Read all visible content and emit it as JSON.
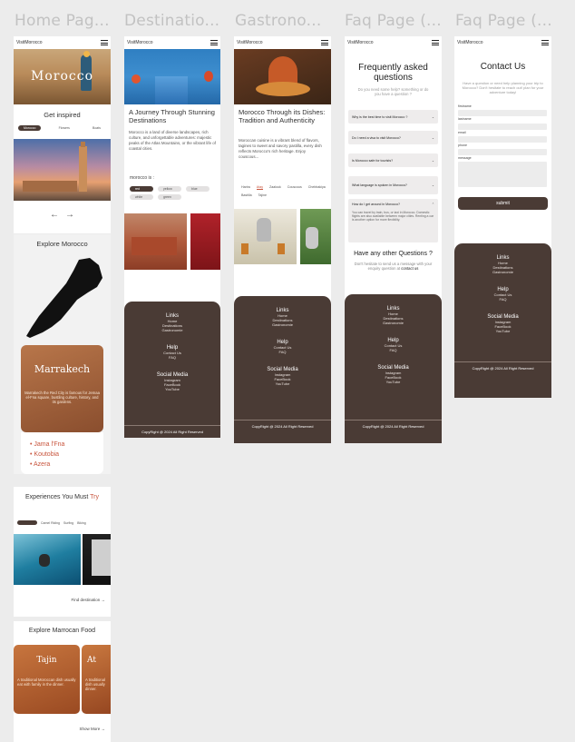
{
  "frames": {
    "home": "Home Pag...",
    "destinations": "Destinatio...",
    "gastronomy": "Gastrono...",
    "faq": "Faq Page (...",
    "contact": "Faq Page (..."
  },
  "brand": "VisitMorocco",
  "home": {
    "hero_title": "Morocco",
    "get_inspired": "Get inspired",
    "inspired_chips": [
      "Morocco",
      "Flowers",
      "Boats"
    ],
    "explore_title": "Explore Morocco",
    "city_name": "Marrakech",
    "city_desc": "Marrakech the Red City is famous for Jemaa el-Fna square, bustling culture, history, and its gardens.",
    "places": [
      "Jama l'Fna",
      "Koutobia",
      "Azera"
    ],
    "experiences_title": "Experiences You Must",
    "experiences_accent": "Try",
    "exp_chips": [
      "",
      "Camel Riding",
      "Surfing",
      "Biking"
    ],
    "find_destination": "Find destination",
    "food_title": "Explore Marrocan Food",
    "food_name": "Tajin",
    "food_name2": "At",
    "food_desc": "A traditional Moroccan dish usually eat with family in the dinner.",
    "food_desc2": "A traditional dish usually dinner.",
    "show_more": "Show More"
  },
  "destinations": {
    "heading": "A Journey Through Stunning Destinations",
    "body": "Morocco is a land of diverse landscapes, rich culture, and unforgettable adventures: majestic peaks of the Atlas Mountains, or the vibrant life of coastal cities.",
    "morocco_is": "morocco is :",
    "chips": [
      "red",
      "yellow",
      "blue",
      "white",
      "green"
    ]
  },
  "gastronomy": {
    "heading": "Morocco Through its Dishes: Tradition and Authenticity",
    "body": "Moroccan cuisine is a vibrant blend of flavors, tagines to sweet and savory pastilla, every dish reflects Morocco's rich heritage. Enjoy couscous...",
    "tabs": [
      "Harira",
      "Atay",
      "Zaalouk",
      "Couscous",
      "Chebbakiya",
      "Bastilla",
      "Tajine"
    ]
  },
  "faq": {
    "heading": "Frequently asked questions",
    "sub": "Do you need some help? something or do you have a question ?",
    "questions": [
      "Why is the best time to visit Morocco ?",
      "Do I need a visa to visit Morocco?",
      "Is Morocco safe for tourists?",
      "What language is spoken in Morocco?",
      "How do I get around in Morocco?"
    ],
    "answer": "You can travel by train, bus, or taxi in Morocco. Domestic flights are also available between major cities. Renting a car is another option for more flexibility.",
    "other_title": "Have any other Questions ?",
    "other_text": "Don't hesitate to send us a message with your enquiry question at",
    "other_link": "contact us"
  },
  "contact": {
    "heading": "Contact Us",
    "sub": "Have a question or need help planning your trip to Morocco? Don't hesitate to reach out! plan for your adventure today!",
    "labels": [
      "firstname",
      "lastname",
      "email",
      "phone",
      "message"
    ],
    "submit": "submit"
  },
  "footer": {
    "links": "Links",
    "link_items": [
      "Home",
      "Destinations",
      "Gastronomie"
    ],
    "help": "Help",
    "help_items": [
      "Contact Us",
      "FAQ"
    ],
    "social": "Social Media",
    "social_items": [
      "Instagram",
      "FaceBook",
      "YouTube"
    ],
    "copyright": "CopyRight @ 2024 All Right Reserved"
  },
  "colors": {
    "brown": "#4a3b35",
    "terracotta": "#c77a3c",
    "accent": "#c8553d"
  }
}
